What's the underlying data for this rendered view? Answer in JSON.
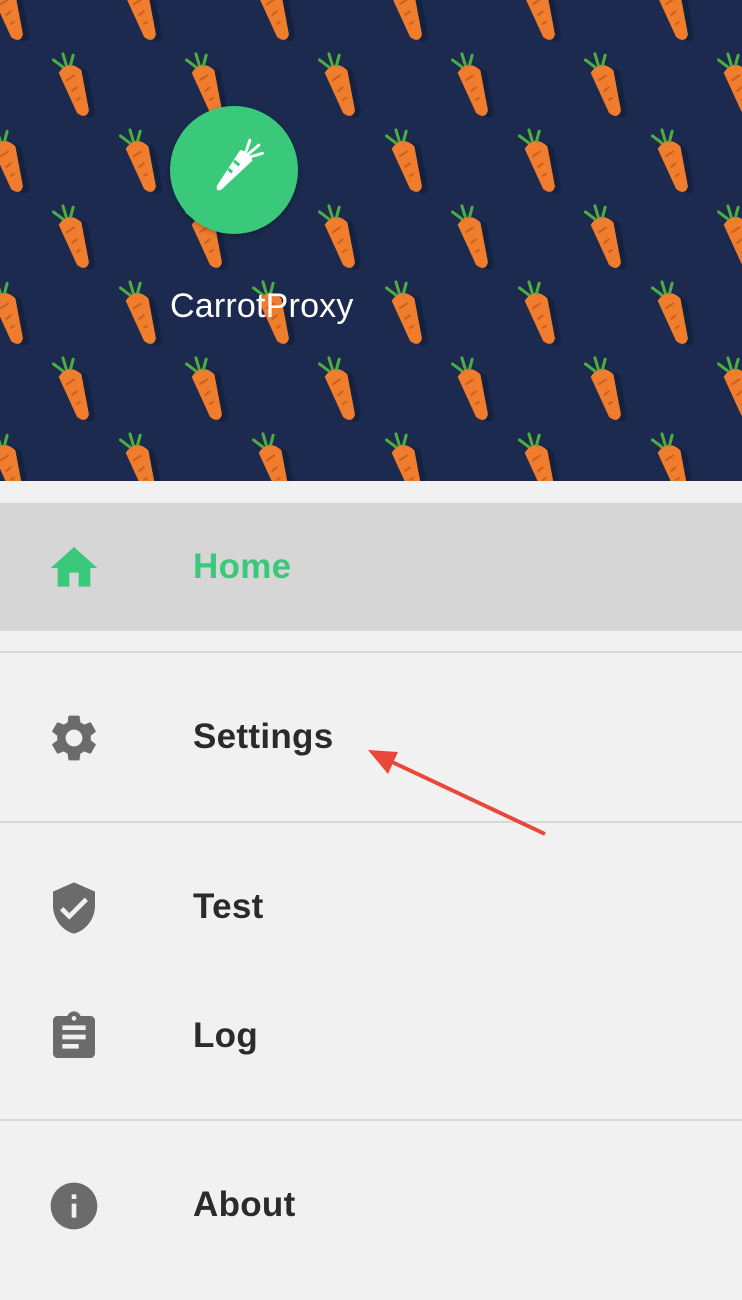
{
  "header": {
    "app_name": "CarrotProxy",
    "background_color": "#1b2a4e",
    "logo_icon": "carrot-icon",
    "logo_color": "#3ac87a"
  },
  "menu": {
    "items": [
      {
        "label": "Home",
        "icon": "home-icon",
        "selected": true
      },
      {
        "label": "Settings",
        "icon": "gear-icon",
        "selected": false
      },
      {
        "label": "Test",
        "icon": "shield-check-icon",
        "selected": false
      },
      {
        "label": "Log",
        "icon": "clipboard-icon",
        "selected": false
      },
      {
        "label": "About",
        "icon": "info-icon",
        "selected": false
      }
    ]
  },
  "colors": {
    "accent": "#3ac87a",
    "text": "#2b2b2b",
    "icon": "#6b6b6b",
    "selected_background": "#d6d6d6",
    "annotation_arrow": "#e8473a"
  }
}
